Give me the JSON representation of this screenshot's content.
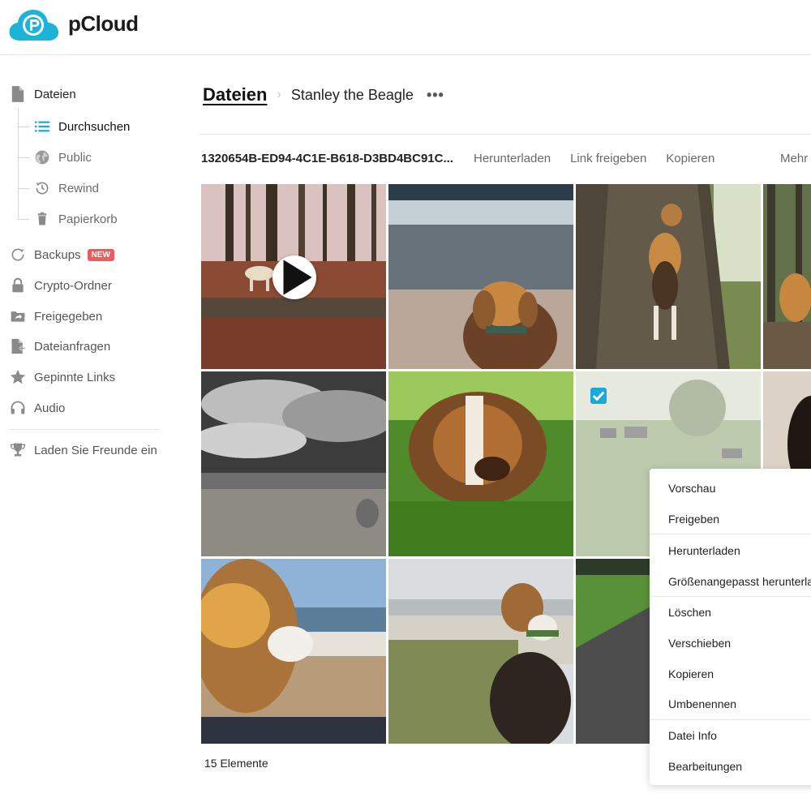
{
  "app": {
    "name": "pCloud"
  },
  "sidebar": {
    "files_label": "Dateien",
    "sub_items": [
      {
        "label": "Durchsuchen",
        "icon": "list-icon",
        "active": true
      },
      {
        "label": "Public",
        "icon": "globe-icon"
      },
      {
        "label": "Rewind",
        "icon": "history-icon"
      },
      {
        "label": "Papierkorb",
        "icon": "trash-icon"
      }
    ],
    "items": [
      {
        "label": "Backups",
        "icon": "backup-icon",
        "badge": "NEW"
      },
      {
        "label": "Crypto-Ordner",
        "icon": "lock-icon"
      },
      {
        "label": "Freigegeben",
        "icon": "shared-folder-icon"
      },
      {
        "label": "Dateianfragen",
        "icon": "file-request-icon"
      },
      {
        "label": "Gepinnte Links",
        "icon": "star-icon"
      },
      {
        "label": "Audio",
        "icon": "headphones-icon"
      }
    ],
    "invite_label": "Laden Sie Freunde ein"
  },
  "breadcrumb": {
    "root": "Dateien",
    "current": "Stanley the Beagle",
    "more": "•••"
  },
  "action_bar": {
    "file_name": "1320654B-ED94-4C1E-B618-D3BD4BC91C...",
    "download": "Herunterladen",
    "share_link": "Link freigeben",
    "copy": "Kopieren",
    "more": "Mehr"
  },
  "footer": {
    "count": "15 Elemente"
  },
  "context_menu": {
    "items": [
      "Vorschau",
      "Freigeben",
      "Herunterladen",
      "Größenangepasst herunterladen",
      "Löschen",
      "Verschieben",
      "Kopieren",
      "Umbenennen",
      "Datei Info",
      "Bearbeitungen"
    ]
  },
  "colors": {
    "accent": "#19a9d8",
    "badge": "#ef5b5b",
    "logo": "#1cb3d8"
  }
}
